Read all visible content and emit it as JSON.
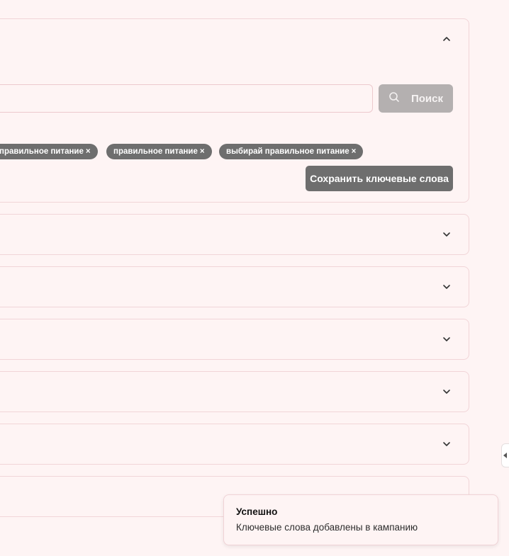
{
  "search": {
    "value": "",
    "placeholder": "",
    "button_label": "Поиск",
    "button_icon": "search-icon"
  },
  "keywords": [
    {
      "label": "правильное питание",
      "remove": "×"
    },
    {
      "label": "правильное питание",
      "remove": "×"
    },
    {
      "label": "выбирай правильное питание",
      "remove": "×"
    }
  ],
  "save_button_label": "Сохранить ключевые слова",
  "panels": {
    "open_icon": "chevron-up-icon",
    "collapsed_icon": "chevron-down-icon",
    "collapsed_count": 6
  },
  "toast": {
    "title": "Успешно",
    "message": "Ключевые слова добавлены в кампанию"
  },
  "colors": {
    "background": "#fef4f4",
    "border": "#f1d5d8",
    "tag_bg": "#6e6e6e",
    "button_disabled": "#b4b0b0",
    "button_dark": "#6e6e6e"
  }
}
